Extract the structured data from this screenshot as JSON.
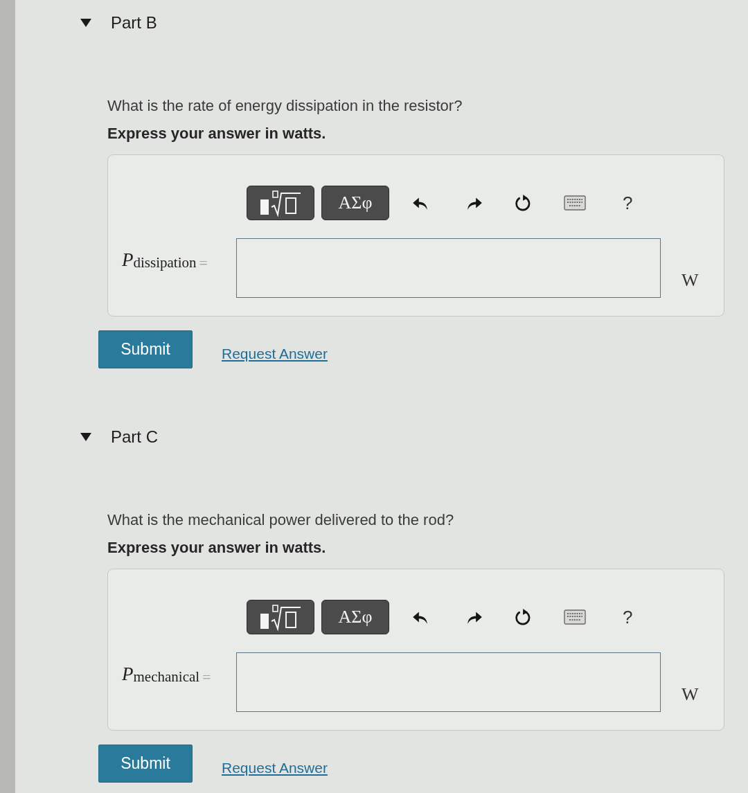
{
  "parts": [
    {
      "title": "Part B",
      "expanded": true,
      "question": "What is the rate of energy dissipation in the resistor?",
      "instruction": "Express your answer in watts.",
      "toolbar": {
        "greek_button": "ΑΣφ",
        "help_button": "?"
      },
      "answer": {
        "variable": "*P*$_{dissipation}$",
        "equals": "=",
        "unit": "W"
      },
      "actions": {
        "submit": "Submit",
        "request_answer": "Request Answer"
      }
    },
    {
      "title": "Part C",
      "expanded": true,
      "question": "What is the mechanical power delivered to the rod?",
      "instruction": "Express your answer in watts.",
      "toolbar": {
        "greek_button": "ΑΣφ",
        "help_button": "?"
      },
      "answer": {
        "variable": "*P*$_{mechanical}$",
        "equals": "=",
        "unit": "W"
      },
      "actions": {
        "submit": "Submit",
        "request_answer": "Request Answer"
      }
    }
  ]
}
